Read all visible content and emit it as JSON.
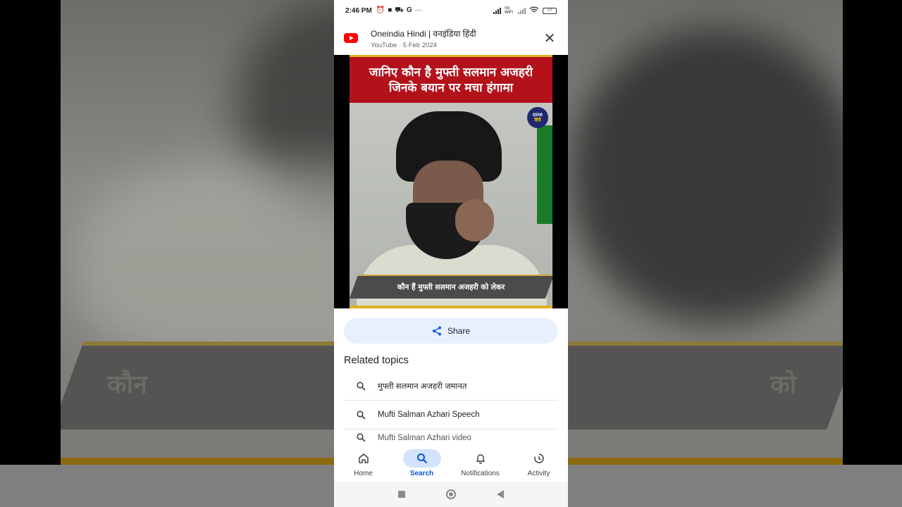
{
  "status": {
    "time": "2:46 PM",
    "left_icons": [
      "alarm-icon",
      "video-icon",
      "car-icon",
      "google-icon",
      "more-icon"
    ],
    "google_letter": "G",
    "network_label": "Vo WiFi",
    "battery": "77"
  },
  "header": {
    "source": "Oneindia Hindi | वनइंडिया हिंदी",
    "meta": "YouTube · 5 Feb 2024",
    "close_glyph": "✕"
  },
  "video": {
    "title_line1": "जानिए कौन है मुफ्ती सलमान अजहरी",
    "title_line2": "जिनके बयान पर मचा हंगामा",
    "badge_line1": "one",
    "badge_line2": "हिंदी",
    "caption": "कौन हैं मुफ्ती सलमान अजहरी को लेकर"
  },
  "share": {
    "label": "Share"
  },
  "related": {
    "title": "Related topics",
    "items": [
      "मुफ्ती सलमान अजहरी जमानत",
      "Mufti Salman Azhari Speech",
      "Mufti Salman Azhari video"
    ]
  },
  "nav": {
    "home": "Home",
    "search": "Search",
    "notifications": "Notifications",
    "activity": "Activity"
  },
  "background": {
    "banner_text": "कौन हैं को लेकर"
  },
  "colors": {
    "accent": "#0b57d0",
    "share_bg": "#e8f0fe",
    "youtube_red": "#ff0000",
    "title_red": "#b3121b",
    "gold": "#e0b020"
  }
}
